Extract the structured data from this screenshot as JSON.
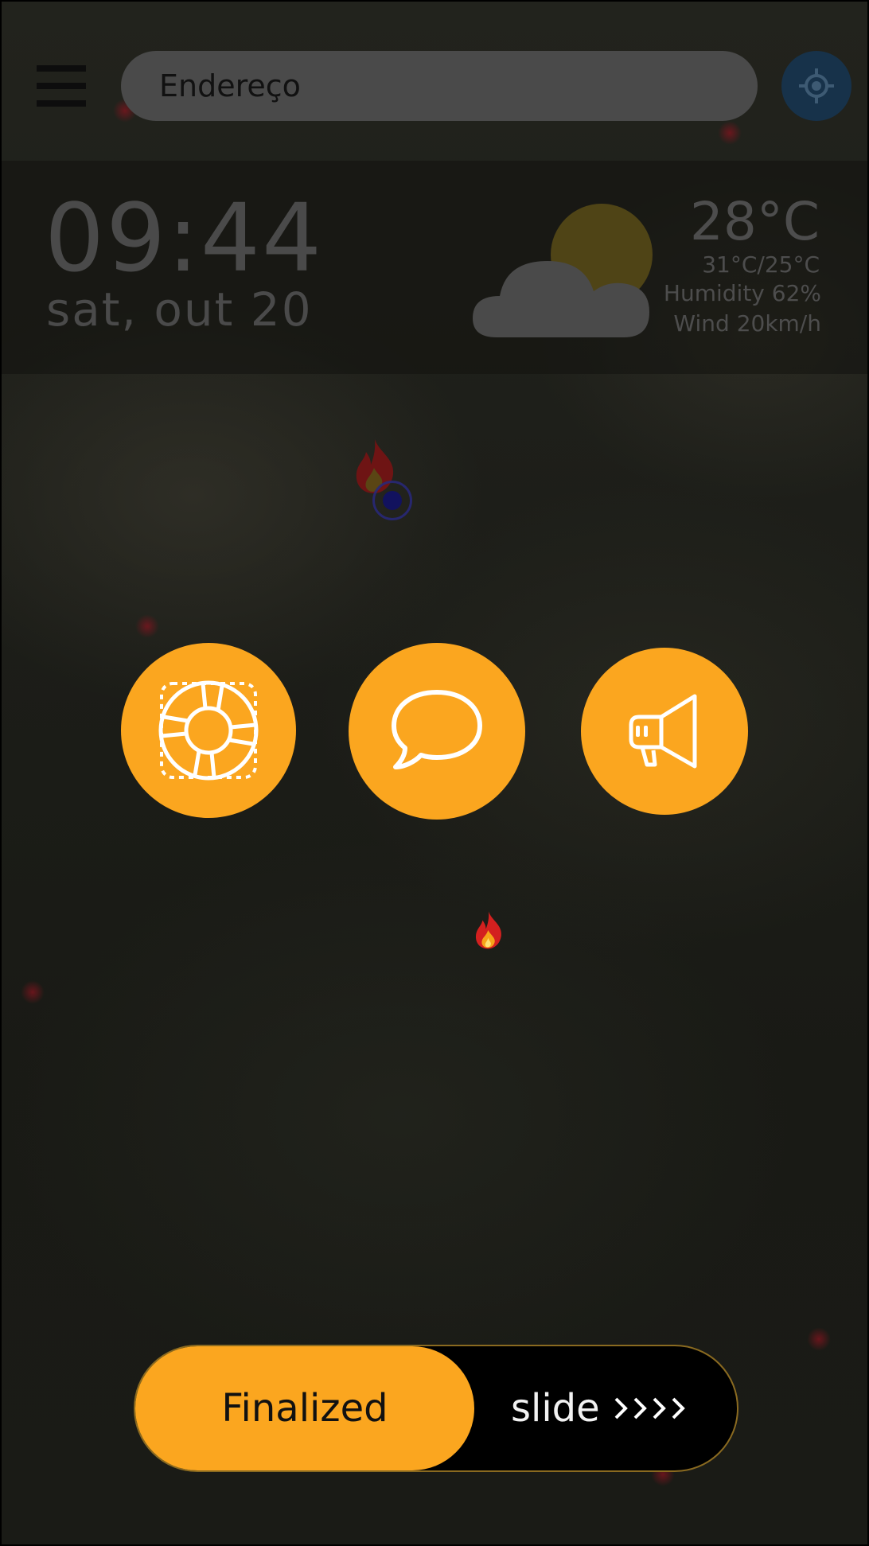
{
  "search": {
    "placeholder": "Endereço"
  },
  "icons": {
    "menu": "hamburger-menu-icon",
    "locate": "crosshair-locate-icon",
    "weather": "partly-cloudy-icon",
    "help": "lifebuoy-icon",
    "chat": "speech-bubble-icon",
    "alert": "megaphone-icon",
    "fire": "fire-icon",
    "arrows": "chevrons-right-icon"
  },
  "clock": {
    "time": "09:44",
    "date": "sat, out 20"
  },
  "weather": {
    "temperature": "28°C",
    "min_max": "31°C/25°C",
    "humidity": "Humidity  62%",
    "wind": "Wind  20km/h"
  },
  "slider": {
    "handle_label": "Finalized",
    "hint": "slide"
  },
  "colors": {
    "accent": "#fba61f",
    "map_bg": "#1b1c17",
    "search_bg": "#4a4a4a",
    "locate_bg": "#17324a",
    "panel_text": "#4a4a4a"
  }
}
